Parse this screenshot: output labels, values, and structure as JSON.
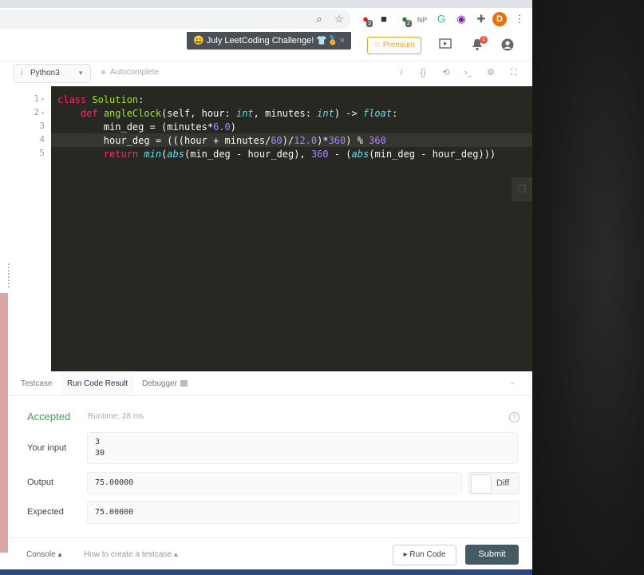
{
  "browser": {
    "extensions": [
      {
        "name": "zoom-icon",
        "glyph": "⌕"
      },
      {
        "name": "star-icon",
        "glyph": "☆"
      },
      {
        "name": "extension-red-icon",
        "glyph": "●",
        "badge": "3",
        "color": "#c62828"
      },
      {
        "name": "extension-dark-icon",
        "glyph": "■",
        "color": "#333"
      },
      {
        "name": "extension-green-icon",
        "glyph": "●",
        "badge": "2",
        "color": "#2e7d32"
      },
      {
        "name": "extension-np-icon",
        "glyph": "NP",
        "color": "#999"
      },
      {
        "name": "grammarly-icon",
        "glyph": "G",
        "color": "#15c39a"
      },
      {
        "name": "extension-purple-icon",
        "glyph": "◉",
        "color": "#7b1fa2"
      },
      {
        "name": "puzzle-icon",
        "glyph": "✚",
        "color": "#5f6368"
      }
    ],
    "avatar_letter": "D",
    "menu_glyph": "⋮"
  },
  "header": {
    "banner_text": "😀 July LeetCoding Challenge! 👕🏅",
    "banner_close": "×",
    "premium_label": "☆ Premium",
    "notification_count": "1"
  },
  "editor": {
    "language": "Python3",
    "autocomplete_label": "Autocomplete",
    "line_numbers": [
      "1",
      "2",
      "3",
      "4",
      "5"
    ]
  },
  "code_lines": [
    [
      {
        "t": "class ",
        "c": "kw"
      },
      {
        "t": "Solution",
        "c": "cls"
      },
      {
        "t": ":",
        "c": ""
      }
    ],
    [
      {
        "t": "    ",
        "c": ""
      },
      {
        "t": "def ",
        "c": "kw"
      },
      {
        "t": "angleClock",
        "c": "fn"
      },
      {
        "t": "(self, hour: ",
        "c": ""
      },
      {
        "t": "int",
        "c": "ty"
      },
      {
        "t": ", minutes: ",
        "c": ""
      },
      {
        "t": "int",
        "c": "ty"
      },
      {
        "t": ") -> ",
        "c": ""
      },
      {
        "t": "float",
        "c": "ty"
      },
      {
        "t": ":",
        "c": ""
      }
    ],
    [
      {
        "t": "        min_deg = (minutes*",
        "c": ""
      },
      {
        "t": "6.0",
        "c": "num"
      },
      {
        "t": ")",
        "c": ""
      }
    ],
    [
      {
        "t": "        hour_deg = (((hour + minutes/",
        "c": ""
      },
      {
        "t": "60",
        "c": "num"
      },
      {
        "t": ")/",
        "c": ""
      },
      {
        "t": "12.0",
        "c": "num"
      },
      {
        "t": ")*",
        "c": ""
      },
      {
        "t": "360",
        "c": "num"
      },
      {
        "t": ") % ",
        "c": ""
      },
      {
        "t": "360",
        "c": "num"
      }
    ],
    [
      {
        "t": "        ",
        "c": ""
      },
      {
        "t": "return ",
        "c": "kw"
      },
      {
        "t": "min",
        "c": "ty"
      },
      {
        "t": "(",
        "c": ""
      },
      {
        "t": "abs",
        "c": "ty"
      },
      {
        "t": "(min_deg - hour_deg), ",
        "c": ""
      },
      {
        "t": "360",
        "c": "num"
      },
      {
        "t": " - (",
        "c": ""
      },
      {
        "t": "abs",
        "c": "ty"
      },
      {
        "t": "(min_deg - hour_deg)))",
        "c": ""
      }
    ]
  ],
  "tabs": {
    "testcase": "Testcase",
    "run_code_result": "Run Code Result",
    "debugger": "Debugger"
  },
  "result": {
    "status": "Accepted",
    "runtime": "Runtime: 28 ms",
    "help": "?",
    "input_label": "Your input",
    "input_lines": [
      "3",
      "30"
    ],
    "output_label": "Output",
    "output_value": "75.00000",
    "diff_label": "Diff",
    "expected_label": "Expected",
    "expected_value": "75.00000"
  },
  "footer": {
    "console": "Console ▴",
    "how_to": "How to create a testcase ▴",
    "run_code": "▸ Run Code",
    "submit": "Submit"
  }
}
